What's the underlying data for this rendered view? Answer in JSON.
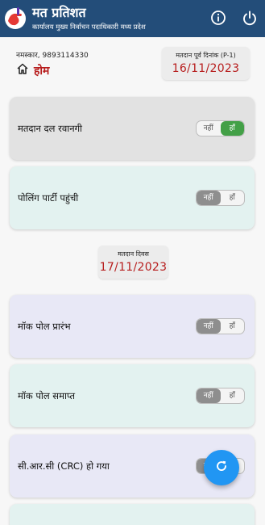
{
  "app": {
    "title": "मत प्रतिशत",
    "subtitle": "कार्यालय मुख्य निर्वाचन पदाधिकारी मध्य प्रदेश"
  },
  "header": {
    "greeting": "नमस्कार, 9893114330",
    "home_label": "होम"
  },
  "pre_poll_date": {
    "label": "मतदान पूर्व दिनांक (P-1)",
    "value": "16/11/2023"
  },
  "poll_date": {
    "label": "मतदान दिवस",
    "value": "17/11/2023"
  },
  "cards": [
    {
      "title": "मतदान दल रवानगी",
      "no_label": "नहीं",
      "yes_label": "हाँ",
      "selected": "yes",
      "bg": "#e2e2e2"
    },
    {
      "title": "पोलिंग पार्टी पहुंची",
      "no_label": "नहीं",
      "yes_label": "हाँ",
      "selected": "no",
      "bg": "#e3f2f0"
    },
    {
      "title": "मॉक पोल प्रारंभ",
      "no_label": "नहीं",
      "yes_label": "हाँ",
      "selected": "no",
      "bg": "#e8e8f6"
    },
    {
      "title": "मॉक पोल समाप्त",
      "no_label": "नहीं",
      "yes_label": "हाँ",
      "selected": "no",
      "bg": "#e3f2f0"
    },
    {
      "title": "सी.आर.सी (CRC) हो गया",
      "no_label": "नहीं",
      "yes_label": "हाँ",
      "selected": "no",
      "bg": "#e8e8f6"
    }
  ],
  "colors": {
    "appbar": "#234d79",
    "accent_red": "#b71c1c",
    "toggle_yes": "#43a047",
    "toggle_no": "#8e8e8e",
    "fab": "#2196f3"
  },
  "icons": {
    "logo": "voting-hand-icon",
    "info": "info-icon",
    "power": "power-icon",
    "home": "home-icon",
    "refresh": "refresh-icon"
  }
}
